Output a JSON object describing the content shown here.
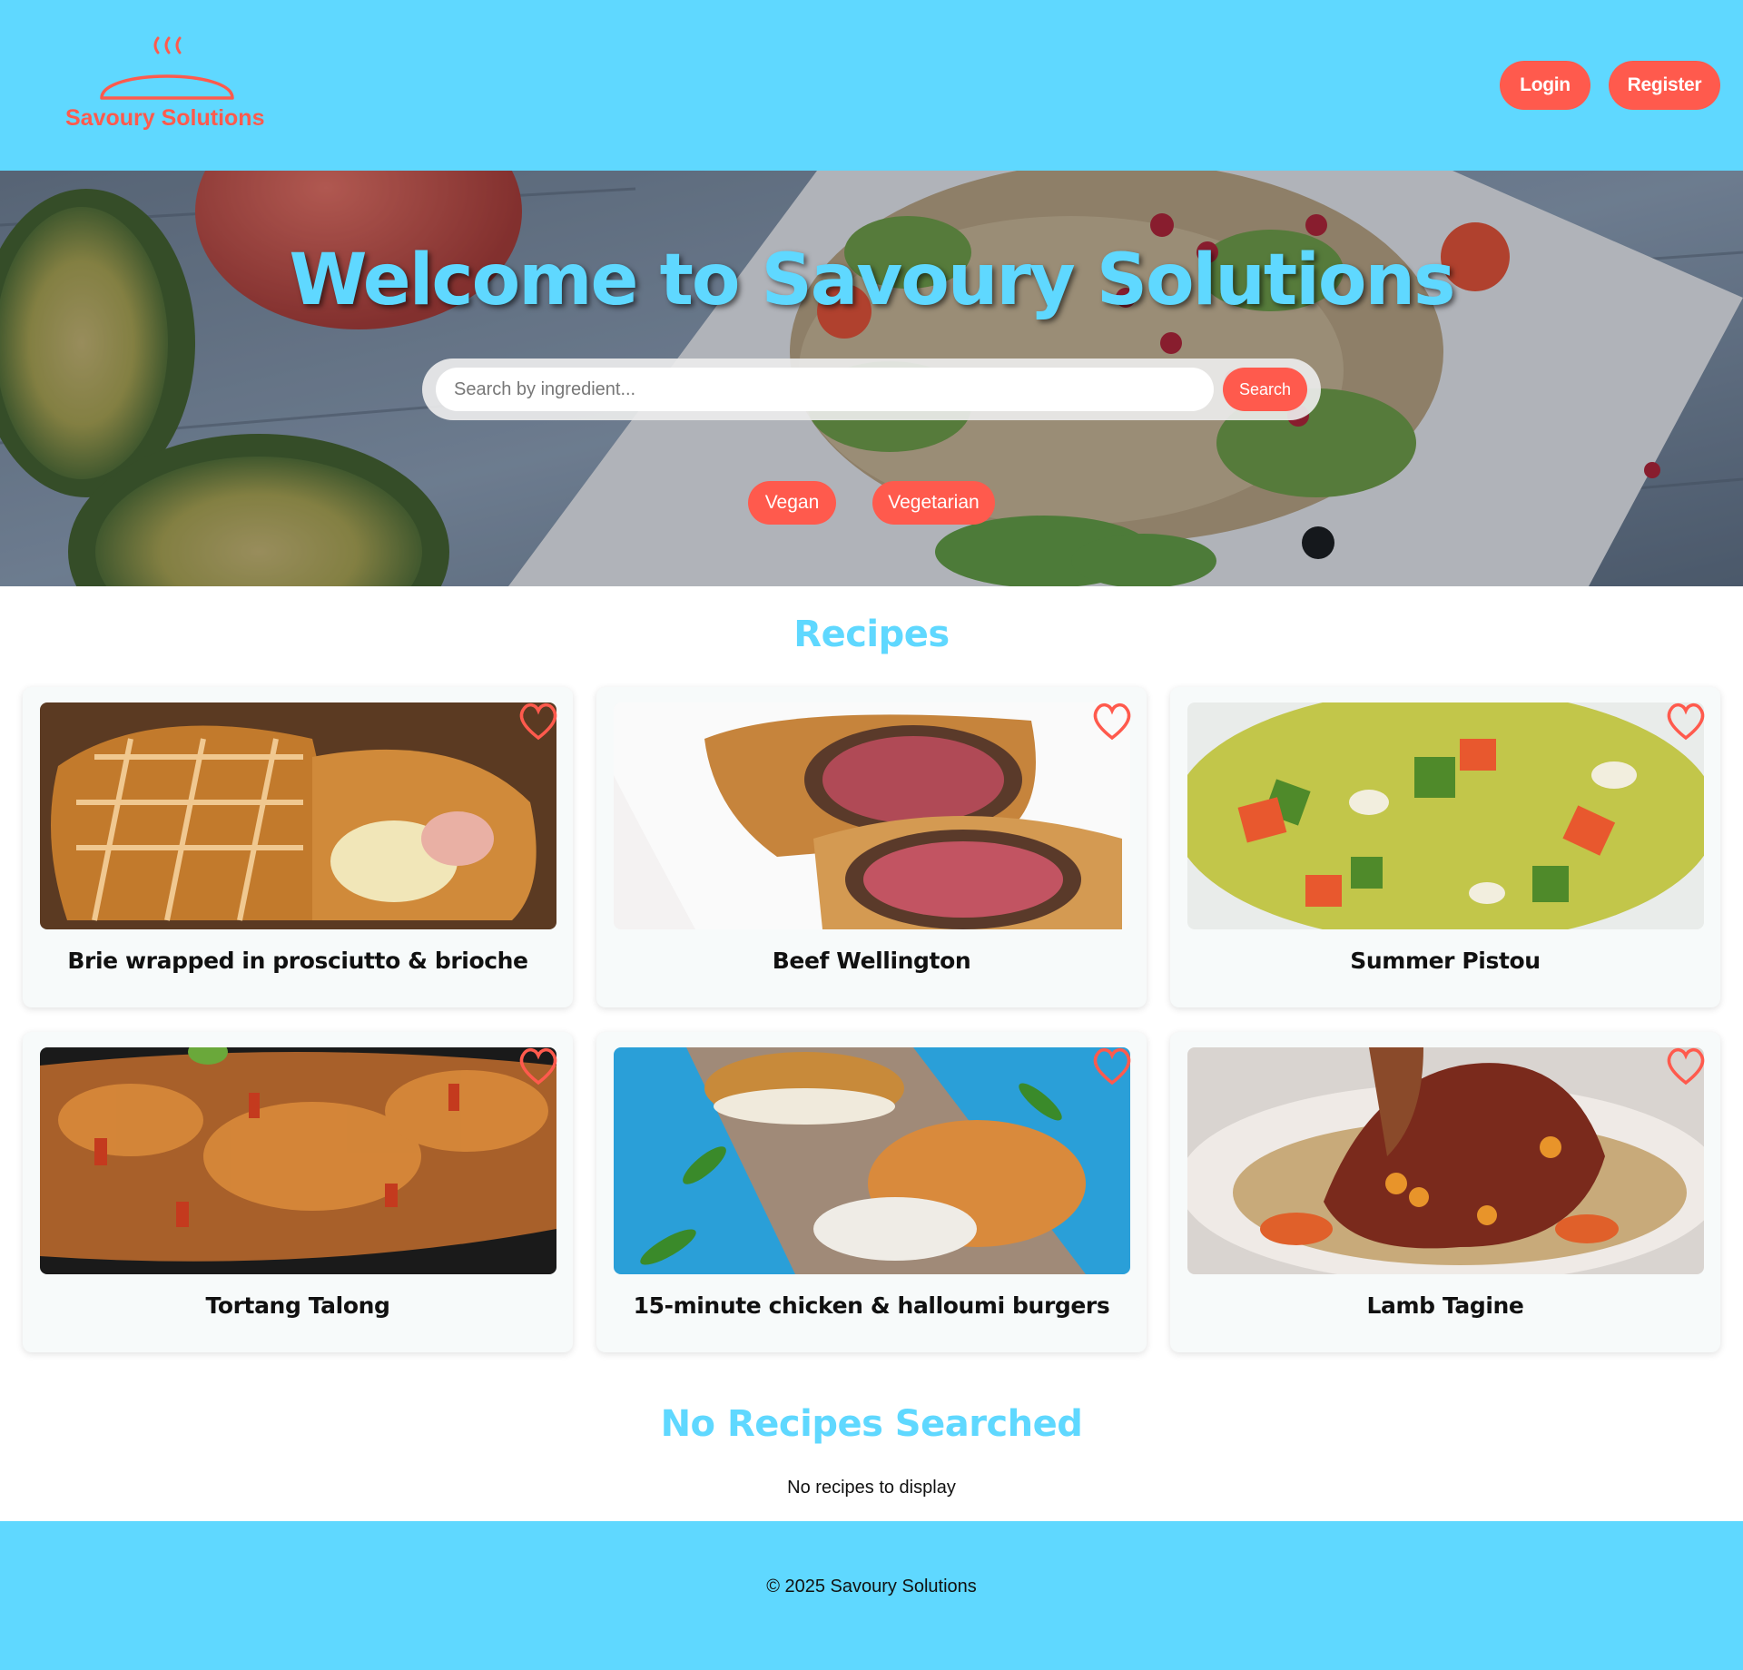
{
  "header": {
    "logo_text": "Savoury Solutions",
    "login_label": "Login",
    "register_label": "Register"
  },
  "hero": {
    "title": "Welcome to Savoury Solutions",
    "search_placeholder": "Search by ingredient...",
    "search_value": "",
    "search_button": "Search",
    "filters": [
      "Vegan",
      "Vegetarian"
    ]
  },
  "recipes": {
    "title": "Recipes",
    "items": [
      {
        "name": "Brie wrapped in prosciutto & brioche",
        "favorited": false
      },
      {
        "name": "Beef Wellington",
        "favorited": false
      },
      {
        "name": "Summer Pistou",
        "favorited": false
      },
      {
        "name": "Tortang Talong",
        "favorited": false
      },
      {
        "name": "15-minute chicken & halloumi burgers",
        "favorited": false
      },
      {
        "name": "Lamb Tagine",
        "favorited": false
      }
    ]
  },
  "search_results": {
    "title": "No Recipes Searched",
    "empty_text": "No recipes to display"
  },
  "footer": {
    "copyright": "© 2025 Savoury Solutions"
  },
  "colors": {
    "accent_blue": "#5fd8ff",
    "accent_red": "#ff5a4d"
  },
  "icons": {
    "logo": "cloche-icon",
    "favorite": "heart-outline-icon"
  }
}
